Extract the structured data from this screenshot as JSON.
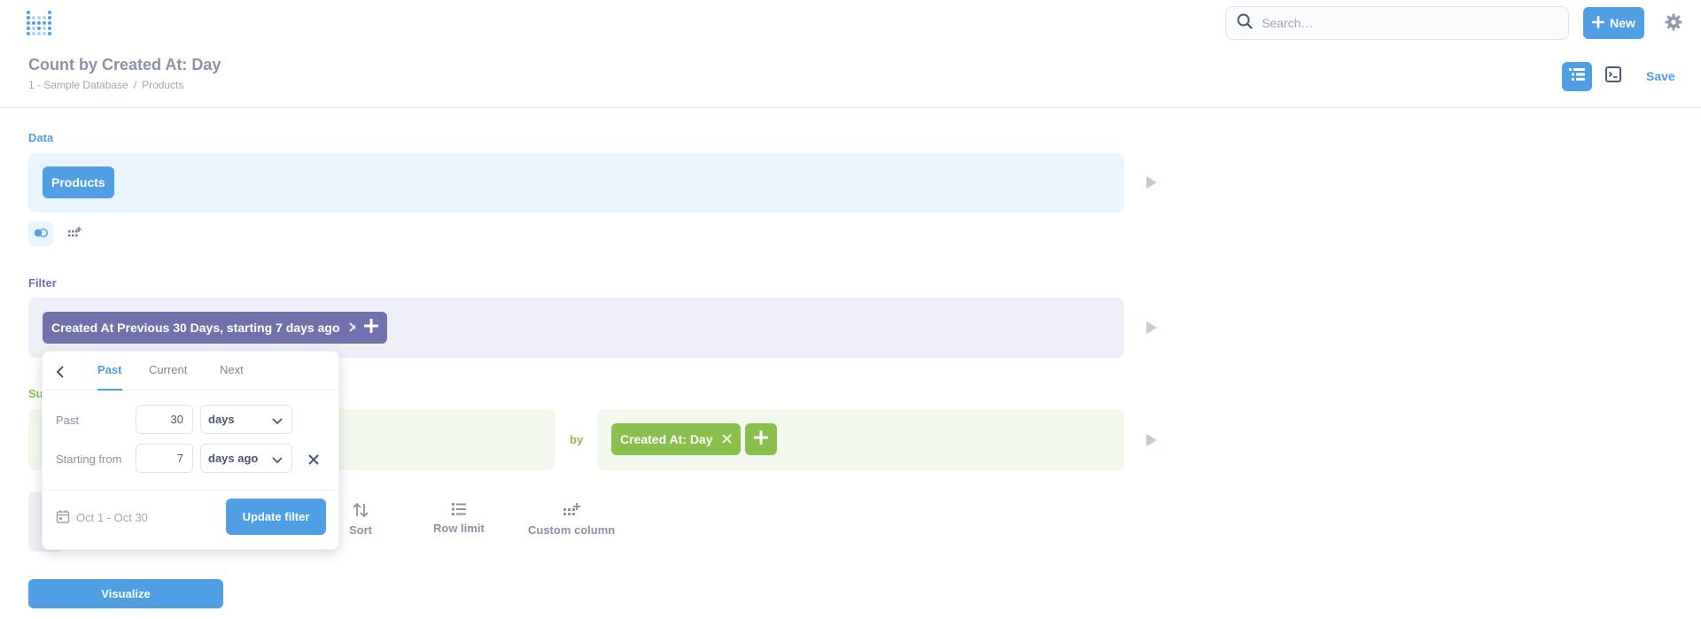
{
  "topbar": {
    "search_placeholder": "Search…",
    "new_label": "New"
  },
  "header": {
    "title": "Count by Created At: Day",
    "breadcrumb": [
      "1 - Sample Database",
      "/",
      "Products"
    ],
    "save_label": "Save"
  },
  "data_section": {
    "label": "Data",
    "table_chip": "Products"
  },
  "filter_section": {
    "label": "Filter",
    "filter_chip": "Created At Previous 30 Days, starting 7 days ago"
  },
  "summarize_section": {
    "label_fragment": "Su",
    "by_label": "by",
    "breakout_chip": "Created At: Day"
  },
  "actions": {
    "sort": "Sort",
    "row_limit": "Row limit",
    "custom_column": "Custom column"
  },
  "visualize_label": "Visualize",
  "date_popover": {
    "tabs": [
      "Past",
      "Current",
      "Next"
    ],
    "active_tab": "Past",
    "past_label": "Past",
    "past_value": "30",
    "past_unit": "days",
    "starting_label": "Starting from",
    "starting_value": "7",
    "starting_unit": "days ago",
    "date_range": "Oct 1 - Oct 30",
    "update_label": "Update filter"
  },
  "colors": {
    "brand": "#509ee3",
    "filter": "#7172ad",
    "summarize": "#88bf4d",
    "data_bg": "#eaf4fd",
    "filter_bg": "#eeeff6",
    "summarize_bg": "#f2f8ec"
  },
  "icons": [
    "metabase-logo-icon",
    "search-icon",
    "plus-icon",
    "gear-icon",
    "notebook-icon",
    "sql-icon",
    "run-icon",
    "join-icon",
    "custom-column-icon",
    "close-icon",
    "chevron-left-icon",
    "chevron-down-icon",
    "calendar-icon",
    "sort-icon",
    "row-limit-icon"
  ]
}
